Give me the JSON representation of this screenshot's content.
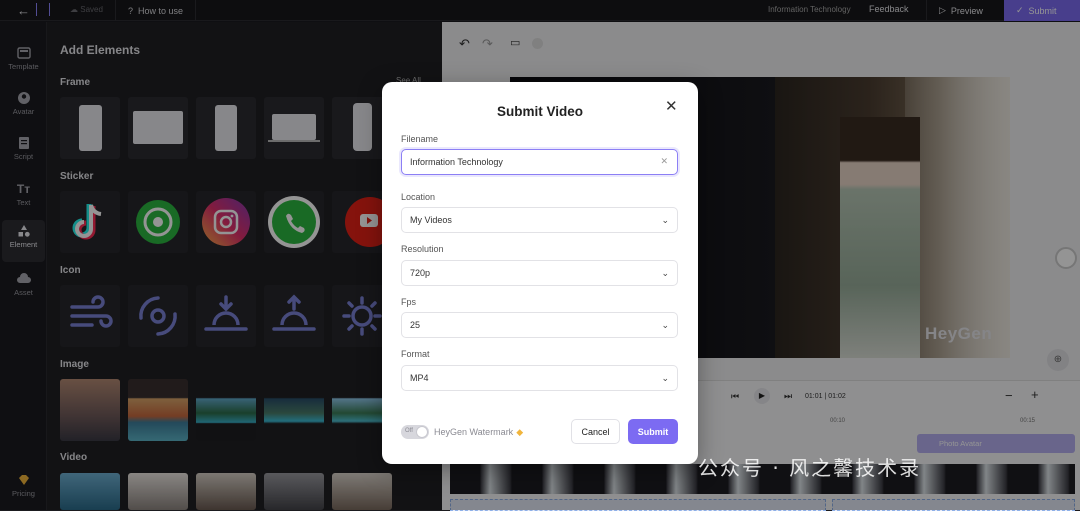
{
  "topbar": {
    "saved": "Saved",
    "how_to_use": "How to use",
    "file_title": "Information Technology",
    "feedback": "Feedback",
    "preview": "Preview",
    "submit": "Submit"
  },
  "rail": [
    "Template",
    "Avatar",
    "Script",
    "Text",
    "Element",
    "Asset",
    "Pricing"
  ],
  "panel": {
    "title": "Add Elements",
    "sections": [
      "Frame",
      "Sticker",
      "Icon",
      "Image",
      "Video"
    ],
    "see_all": "See All"
  },
  "video_brand": "HeyGen",
  "timeline": {
    "time_current": "01:01",
    "time_total": "01:02",
    "mark1": "00:10",
    "mark2": "00:15",
    "photo_avatar": "Photo Avatar"
  },
  "modal": {
    "title": "Submit Video",
    "filename_label": "Filename",
    "filename_value": "Information Technology",
    "location_label": "Location",
    "location_value": "My Videos",
    "resolution_label": "Resolution",
    "resolution_value": "720p",
    "fps_label": "Fps",
    "fps_value": "25",
    "format_label": "Format",
    "format_value": "MP4",
    "toggle_off": "Off",
    "watermark_label": "HeyGen Watermark",
    "cancel": "Cancel",
    "submit": "Submit"
  },
  "overlay_watermark": "公众号 · 风之馨技术录",
  "colors": {
    "accent": "#7c6bf2",
    "dark_bg": "#1b1b1f"
  }
}
